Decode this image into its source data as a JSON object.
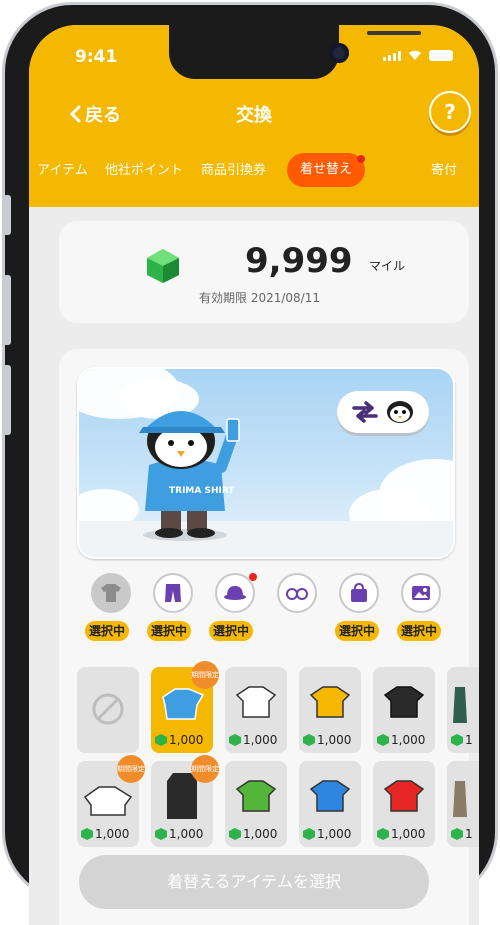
{
  "status_bar": {
    "time": "9:41"
  },
  "header": {
    "back_label": "戻る",
    "title": "交換",
    "help_label": "?"
  },
  "tabs": [
    {
      "label": "アイテム"
    },
    {
      "label": "他社ポイント"
    },
    {
      "label": "商品引換券"
    },
    {
      "label": "着せ替え",
      "active": true,
      "has_notification": true
    },
    {
      "label": "寄付"
    }
  ],
  "balance": {
    "value": "9,999",
    "unit": "マイル",
    "expiry": "有効期限 2021/08/11"
  },
  "categories": [
    {
      "icon": "shirt-icon",
      "badge": "選択中"
    },
    {
      "icon": "pants-icon",
      "badge": "選択中"
    },
    {
      "icon": "hat-icon",
      "badge": "選択中",
      "has_notification": true
    },
    {
      "icon": "glasses-icon",
      "badge": ""
    },
    {
      "icon": "bag-icon",
      "badge": "選択中"
    },
    {
      "icon": "background-image-icon",
      "badge": "選択中"
    }
  ],
  "items_row1": [
    {
      "kind": "none",
      "price": ""
    },
    {
      "kind": "blue-shirt",
      "price": "1,000",
      "limited": "期間限定",
      "selected": true
    },
    {
      "kind": "white-shirt",
      "price": "1,000"
    },
    {
      "kind": "yellow-shirt",
      "price": "1,000"
    },
    {
      "kind": "black-shirt",
      "price": "1,000"
    },
    {
      "kind": "coat",
      "price": "1"
    }
  ],
  "items_row2": [
    {
      "kind": "white-shirt-2",
      "price": "1,000",
      "limited": "期間限定"
    },
    {
      "kind": "black-coat",
      "price": "1,000",
      "limited": "期間限定"
    },
    {
      "kind": "green-shirt",
      "price": "1,000"
    },
    {
      "kind": "blue-shirt-2",
      "price": "1,000"
    },
    {
      "kind": "red-shirt",
      "price": "1,000"
    },
    {
      "kind": "coat-2",
      "price": "1"
    }
  ],
  "cta_label": "着替えるアイテムを選択",
  "shirt_print": "TRIMA SHIRT",
  "colors": {
    "brand": "#f5b800",
    "active_tab": "#ff5a00",
    "notification": "#e8261f",
    "limited": "#f08c2a",
    "gem": "#2db34a"
  }
}
